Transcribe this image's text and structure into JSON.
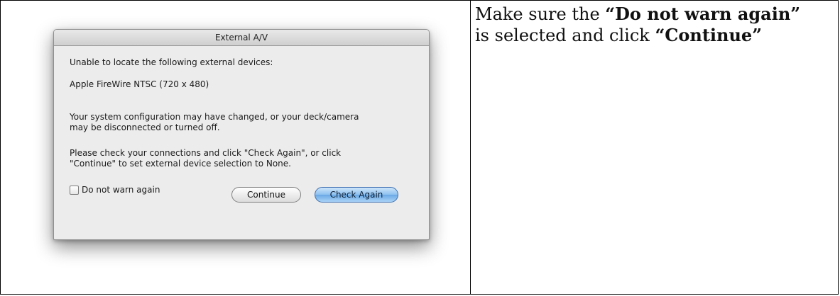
{
  "dialog": {
    "title": "External A/V",
    "line1": "Unable to locate the following external devices:",
    "device": "Apple FireWire NTSC (720 x 480)",
    "para1_line1": "Your system configuration may have changed, or your deck/camera",
    "para1_line2": "may be disconnected or turned off.",
    "para2_line1": "Please check your connections and click \"Check Again\", or click",
    "para2_line2": "\"Continue\" to set external device selection to None.",
    "checkbox_label": "Do not warn again",
    "checkbox_checked": false,
    "continue_label": "Continue",
    "check_again_label": "Check Again"
  },
  "instruction": {
    "part1": "Make sure the ",
    "bold1": "“Do not warn again”",
    "part2": " is selected and click ",
    "bold2": "“Continue”"
  }
}
